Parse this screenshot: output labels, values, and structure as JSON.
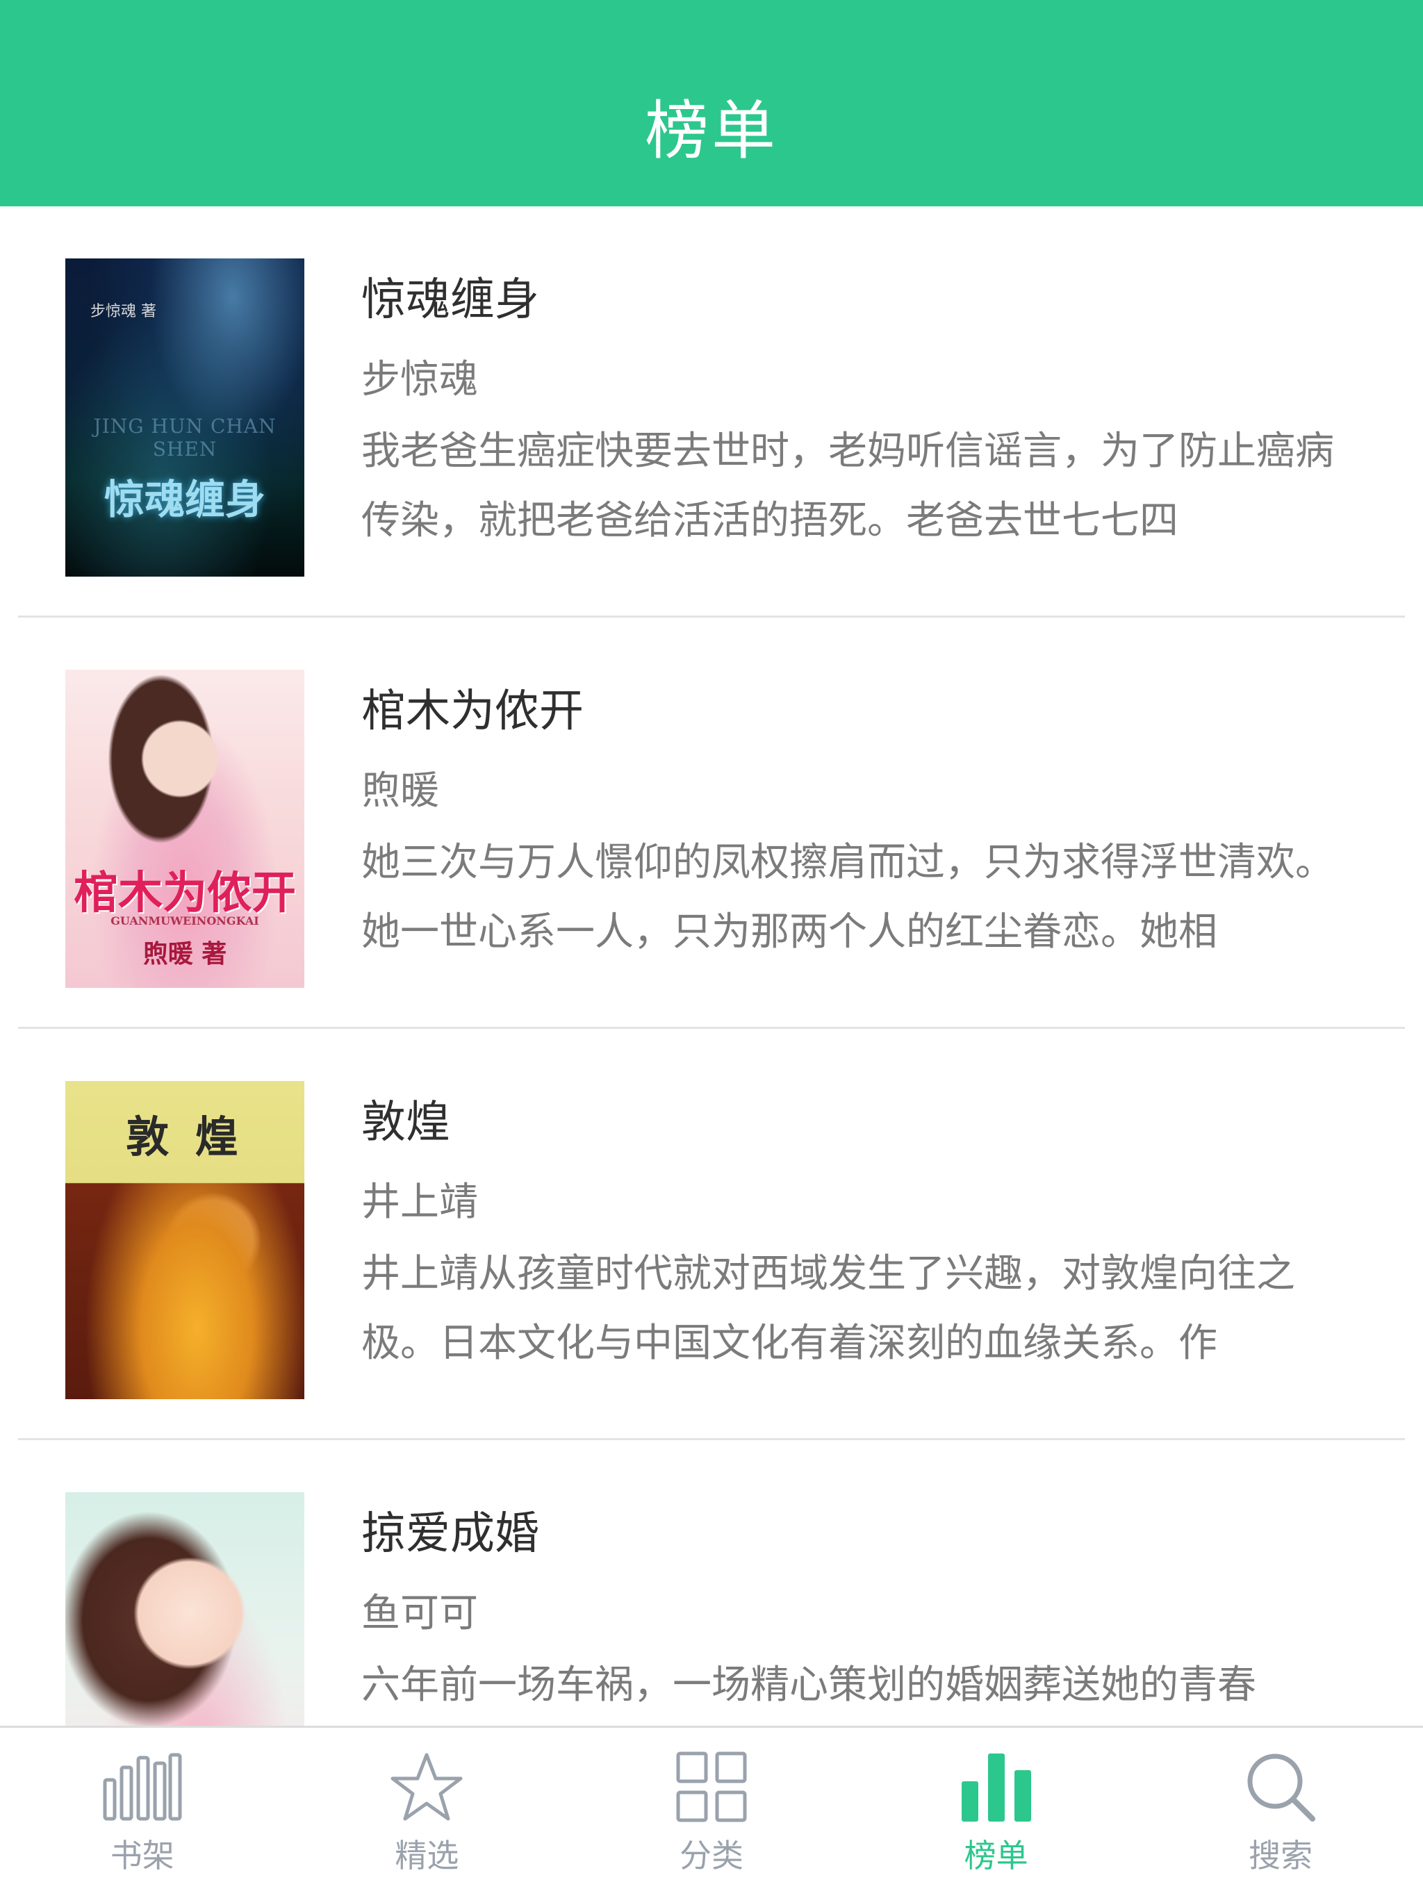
{
  "header": {
    "title": "榜单"
  },
  "books": [
    {
      "title": "惊魂缠身",
      "author": "步惊魂",
      "description": "我老爸生癌症快要去世时，老妈听信谣言，为了防止癌病传染，就把老爸给活活的捂死。老爸去世七七四",
      "cover": {
        "title": "惊魂缠身",
        "subtitle": "JING HUN CHAN SHEN",
        "top_text": "步惊魂 著"
      }
    },
    {
      "title": "棺木为侬开",
      "author": "煦暖",
      "description": "她三次与万人憬仰的凤权擦肩而过，只为求得浮世清欢。她一世心系一人，只为那两个人的红尘眷恋。她相",
      "cover": {
        "title": "棺木为侬开",
        "subtitle": "GUANMUWEINONGKAI",
        "top_text": "煦暖 著"
      }
    },
    {
      "title": "敦煌",
      "author": "井上靖",
      "description": "井上靖从孩童时代就对西域发生了兴趣，对敦煌向往之极。日本文化与中国文化有着深刻的血缘关系。作",
      "cover": {
        "title": "敦 煌"
      }
    },
    {
      "title": "掠爱成婚",
      "author": "鱼可可",
      "description": "六年前一场车祸，一场精心策划的婚姻葬送她的青春"
    }
  ],
  "tabs": [
    {
      "label": "书架",
      "icon": "bookshelf-icon",
      "active": false
    },
    {
      "label": "精选",
      "icon": "star-icon",
      "active": false
    },
    {
      "label": "分类",
      "icon": "grid-icon",
      "active": false
    },
    {
      "label": "榜单",
      "icon": "bar-chart-icon",
      "active": true
    },
    {
      "label": "搜索",
      "icon": "search-icon",
      "active": false
    }
  ],
  "colors": {
    "accent": "#2cc78d",
    "inactive": "#9aa2ac",
    "text": "#2f2f2f",
    "subtext": "#7b7b7b"
  }
}
